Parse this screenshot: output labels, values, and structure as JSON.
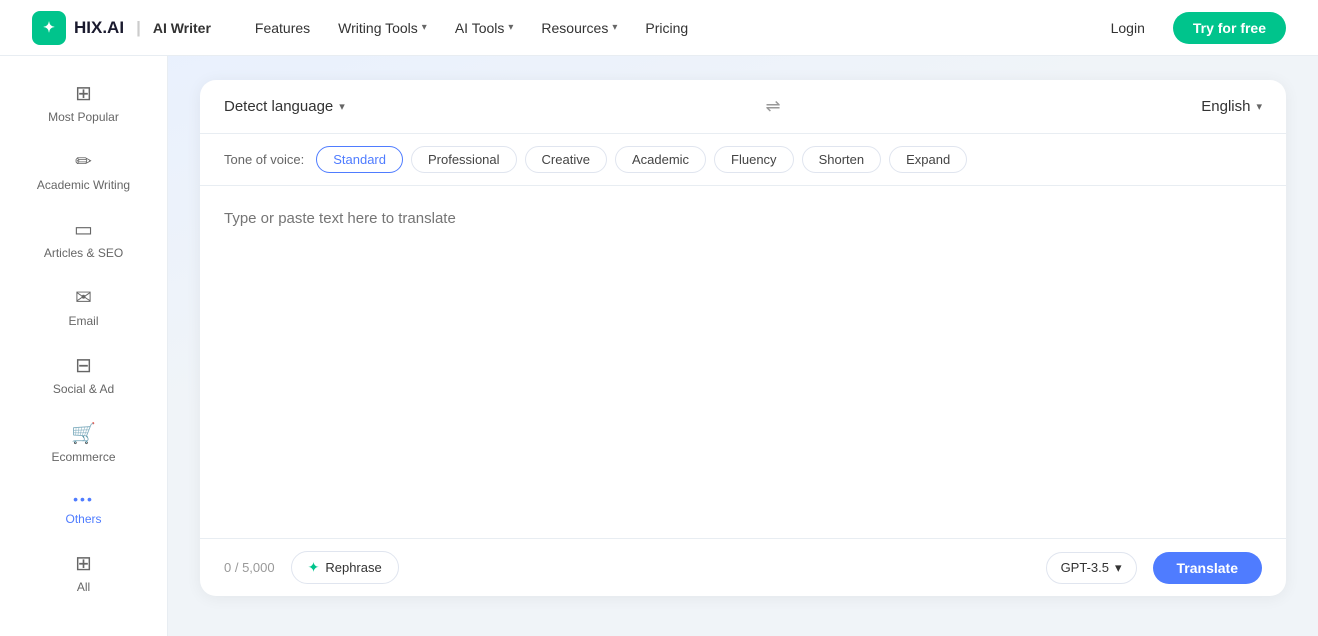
{
  "nav": {
    "logo_text": "HIX.AI",
    "logo_badge": "AI Writer",
    "links": [
      {
        "label": "Features",
        "has_dropdown": false
      },
      {
        "label": "Writing Tools",
        "has_dropdown": true
      },
      {
        "label": "AI Tools",
        "has_dropdown": true
      },
      {
        "label": "Resources",
        "has_dropdown": true
      },
      {
        "label": "Pricing",
        "has_dropdown": false
      }
    ],
    "login_label": "Login",
    "try_label": "Try for free"
  },
  "sidebar": {
    "items": [
      {
        "label": "Most Popular",
        "icon": "⊞"
      },
      {
        "label": "Academic Writing",
        "icon": "✏"
      },
      {
        "label": "Articles & SEO",
        "icon": "▭"
      },
      {
        "label": "Email",
        "icon": "✉"
      },
      {
        "label": "Social & Ad",
        "icon": "⊟"
      },
      {
        "label": "Ecommerce",
        "icon": "🛒"
      },
      {
        "label": "Others",
        "icon": "···"
      },
      {
        "label": "All",
        "icon": "⊞"
      }
    ]
  },
  "toolbar": {
    "detect_language_label": "Detect language",
    "swap_icon": "⇌",
    "target_language": "English",
    "tone_label": "Tone of voice:",
    "tones": [
      "Standard",
      "Professional",
      "Creative",
      "Academic",
      "Fluency",
      "Shorten",
      "Expand"
    ],
    "selected_tone": "Standard"
  },
  "editor": {
    "placeholder": "Type or paste text here to translate"
  },
  "footer": {
    "char_count": "0 / 5,000",
    "rephrase_label": "Rephrase",
    "gpt_label": "GPT-3.5",
    "translate_label": "Translate"
  }
}
